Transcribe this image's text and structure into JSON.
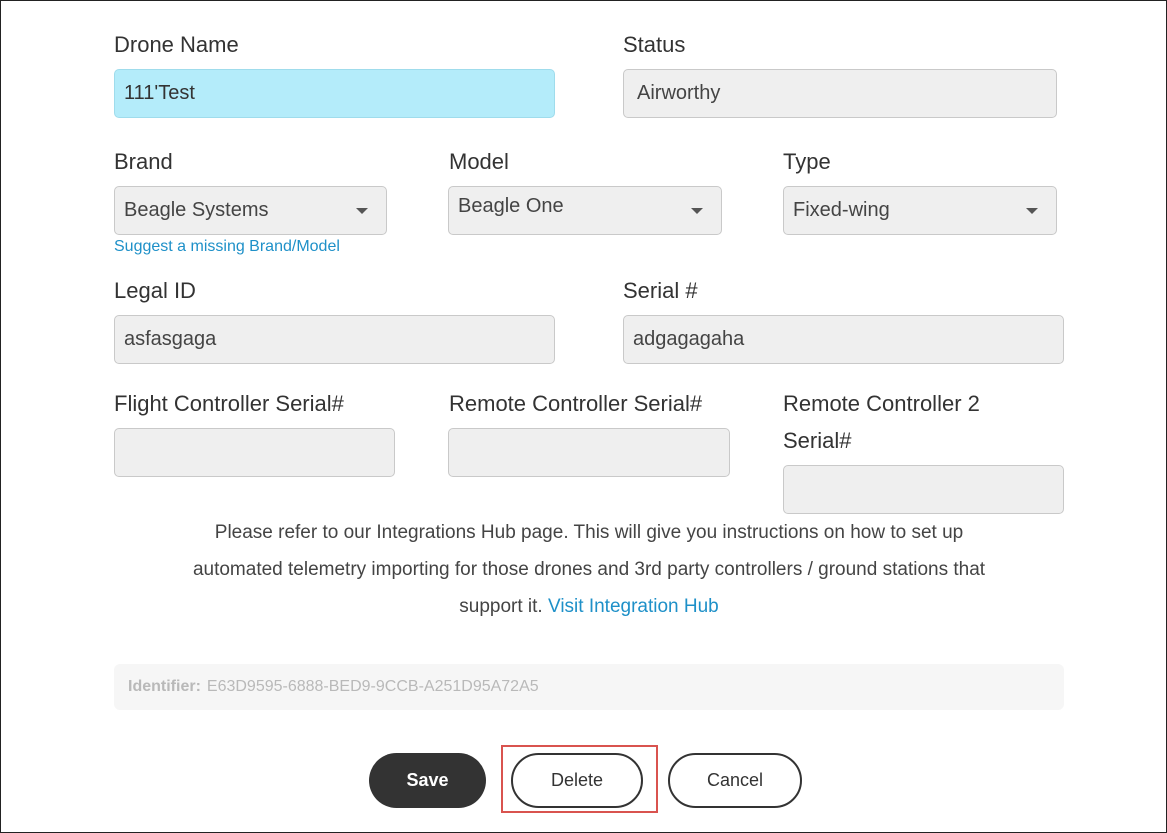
{
  "form": {
    "drone_name": {
      "label": "Drone Name",
      "value": "111'Test"
    },
    "status": {
      "label": "Status",
      "value": "Airworthy"
    },
    "brand": {
      "label": "Brand",
      "value": "Beagle Systems"
    },
    "model": {
      "label": "Model",
      "value": "Beagle One"
    },
    "type": {
      "label": "Type",
      "value": "Fixed-wing"
    },
    "suggest_link": "Suggest a missing Brand/Model",
    "legal_id": {
      "label": "Legal ID",
      "value": "asfasgaga"
    },
    "serial": {
      "label": "Serial #",
      "value": "adgagagaha"
    },
    "flight_controller_serial": {
      "label": "Flight Controller Serial#",
      "value": ""
    },
    "remote_controller_serial": {
      "label": "Remote Controller Serial#",
      "value": ""
    },
    "remote_controller_2_serial": {
      "label_line1": "Remote Controller 2",
      "label_line2": "Serial#",
      "value": ""
    }
  },
  "info": {
    "line1": "Please refer to our Integrations Hub page. This will give you instructions on how to set up",
    "line2": "automated telemetry importing for those drones and 3rd party controllers / ground stations that",
    "line3": "support it.",
    "link": "Visit Integration Hub"
  },
  "identifier": {
    "label": "Identifier:",
    "value": "E63D9595-6888-BED9-9CCB-A251D95A72A5"
  },
  "buttons": {
    "save": "Save",
    "delete": "Delete",
    "cancel": "Cancel"
  },
  "colors": {
    "active_field": "#b4ecfa",
    "link": "#1e90c8",
    "primary_button": "#333333",
    "highlight": "#d9534f"
  }
}
